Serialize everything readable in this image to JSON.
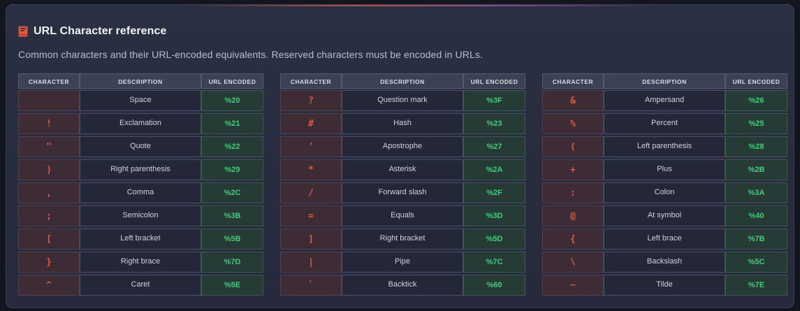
{
  "header": {
    "title": "URL Character reference",
    "subtitle": "Common characters and their URL-encoded equivalents. Reserved characters must be encoded in URLs.",
    "icon": "book-icon",
    "icon_color": "#e0563a"
  },
  "columns": {
    "character": "CHARACTER",
    "description": "DESCRIPTION",
    "encoded": "URL ENCODED"
  },
  "colors": {
    "character_text": "#e2583a",
    "encoded_text": "#3ecf7a"
  },
  "tables": [
    {
      "rows": [
        {
          "char": " ",
          "desc": "Space",
          "enc": "%20"
        },
        {
          "char": "!",
          "desc": "Exclamation",
          "enc": "%21"
        },
        {
          "char": "\"",
          "desc": "Quote",
          "enc": "%22"
        },
        {
          "char": ")",
          "desc": "Right parenthesis",
          "enc": "%29"
        },
        {
          "char": ",",
          "desc": "Comma",
          "enc": "%2C"
        },
        {
          "char": ";",
          "desc": "Semicolon",
          "enc": "%3B"
        },
        {
          "char": "[",
          "desc": "Left bracket",
          "enc": "%5B"
        },
        {
          "char": "}",
          "desc": "Right brace",
          "enc": "%7D"
        },
        {
          "char": "^",
          "desc": "Caret",
          "enc": "%5E"
        }
      ]
    },
    {
      "rows": [
        {
          "char": "?",
          "desc": "Question mark",
          "enc": "%3F"
        },
        {
          "char": "#",
          "desc": "Hash",
          "enc": "%23"
        },
        {
          "char": "'",
          "desc": "Apostrophe",
          "enc": "%27"
        },
        {
          "char": "*",
          "desc": "Asterisk",
          "enc": "%2A"
        },
        {
          "char": "/",
          "desc": "Forward slash",
          "enc": "%2F"
        },
        {
          "char": "=",
          "desc": "Equals",
          "enc": "%3D"
        },
        {
          "char": "]",
          "desc": "Right bracket",
          "enc": "%5D"
        },
        {
          "char": "|",
          "desc": "Pipe",
          "enc": "%7C"
        },
        {
          "char": "`",
          "desc": "Backtick",
          "enc": "%60"
        }
      ]
    },
    {
      "rows": [
        {
          "char": "&",
          "desc": "Ampersand",
          "enc": "%26"
        },
        {
          "char": "%",
          "desc": "Percent",
          "enc": "%25"
        },
        {
          "char": "(",
          "desc": "Left parenthesis",
          "enc": "%28"
        },
        {
          "char": "+",
          "desc": "Plus",
          "enc": "%2B"
        },
        {
          "char": ":",
          "desc": "Colon",
          "enc": "%3A"
        },
        {
          "char": "@",
          "desc": "At symbol",
          "enc": "%40"
        },
        {
          "char": "{",
          "desc": "Left brace",
          "enc": "%7B"
        },
        {
          "char": "\\",
          "desc": "Backslash",
          "enc": "%5C"
        },
        {
          "char": "~",
          "desc": "Tilde",
          "enc": "%7E"
        }
      ]
    }
  ]
}
